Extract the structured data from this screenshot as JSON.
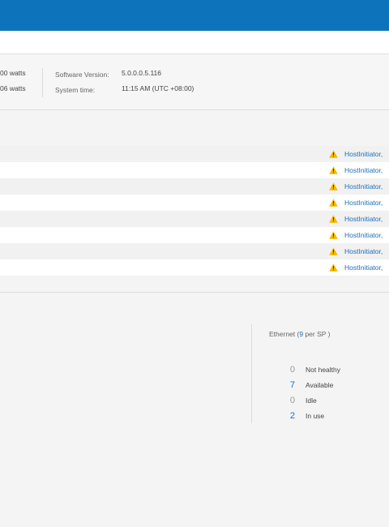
{
  "system_info": {
    "power_current": "00 watts",
    "power_average": "06 watts",
    "software_version_label": "Software Version:",
    "software_version_value": "5.0.0.0.5.116",
    "system_time_label": "System time:",
    "system_time_value": "11:15 AM (UTC +08:00)"
  },
  "alerts": [
    {
      "text": "HostInitiator,"
    },
    {
      "text": "HostInitiator,"
    },
    {
      "text": "HostInitiator,"
    },
    {
      "text": "HostInitiator,"
    },
    {
      "text": "HostInitiator,"
    },
    {
      "text": "HostInitiator,"
    },
    {
      "text": "HostInitiator,"
    },
    {
      "text": "HostInitiator,"
    }
  ],
  "ethernet": {
    "title_prefix": "Ethernet (",
    "count": "9",
    "title_suffix": " per SP )",
    "stats": [
      {
        "value": "0",
        "label": "Not healthy",
        "color": "#999999"
      },
      {
        "value": "7",
        "label": "Available",
        "color": "#1f6fb5"
      },
      {
        "value": "0",
        "label": "Idle",
        "color": "#999999"
      },
      {
        "value": "2",
        "label": "In use",
        "color": "#1f6fb5"
      }
    ]
  },
  "colors": {
    "header": "#0d74bc",
    "link": "#1f6fb5",
    "warning": "#f5b800"
  }
}
